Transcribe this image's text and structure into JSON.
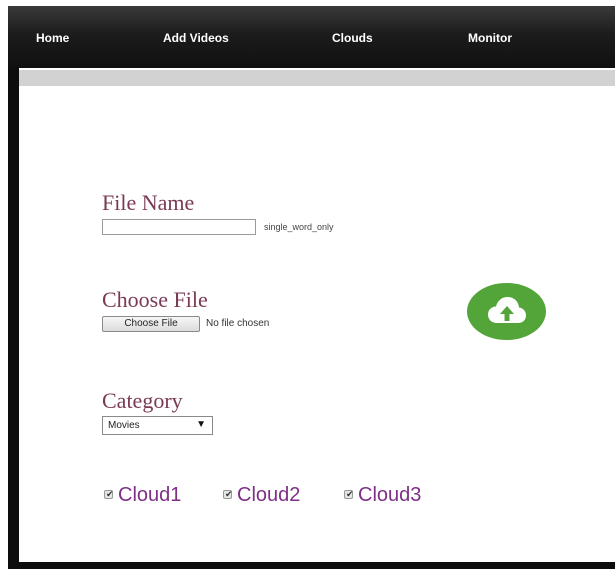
{
  "nav": {
    "items": [
      "Home",
      "Add Videos",
      "Clouds",
      "Monitor"
    ]
  },
  "form": {
    "file_name_label": "File Name",
    "file_name_value": "",
    "file_name_hint": "single_word_only",
    "choose_file_label": "Choose File",
    "choose_file_button": "Choose File",
    "choose_file_status": "No file chosen",
    "category_label": "Category",
    "category_selected": "Movies",
    "clouds": [
      {
        "label": "Cloud1",
        "checked": true
      },
      {
        "label": "Cloud2",
        "checked": true
      },
      {
        "label": "Cloud3",
        "checked": true
      }
    ]
  },
  "upload": {
    "icon": "cloud-upload-icon",
    "color": "#53a53a"
  },
  "colors": {
    "label_text": "#7a3a55",
    "cloud_text": "#7e2f86",
    "navbar": "#1c1c1c"
  }
}
